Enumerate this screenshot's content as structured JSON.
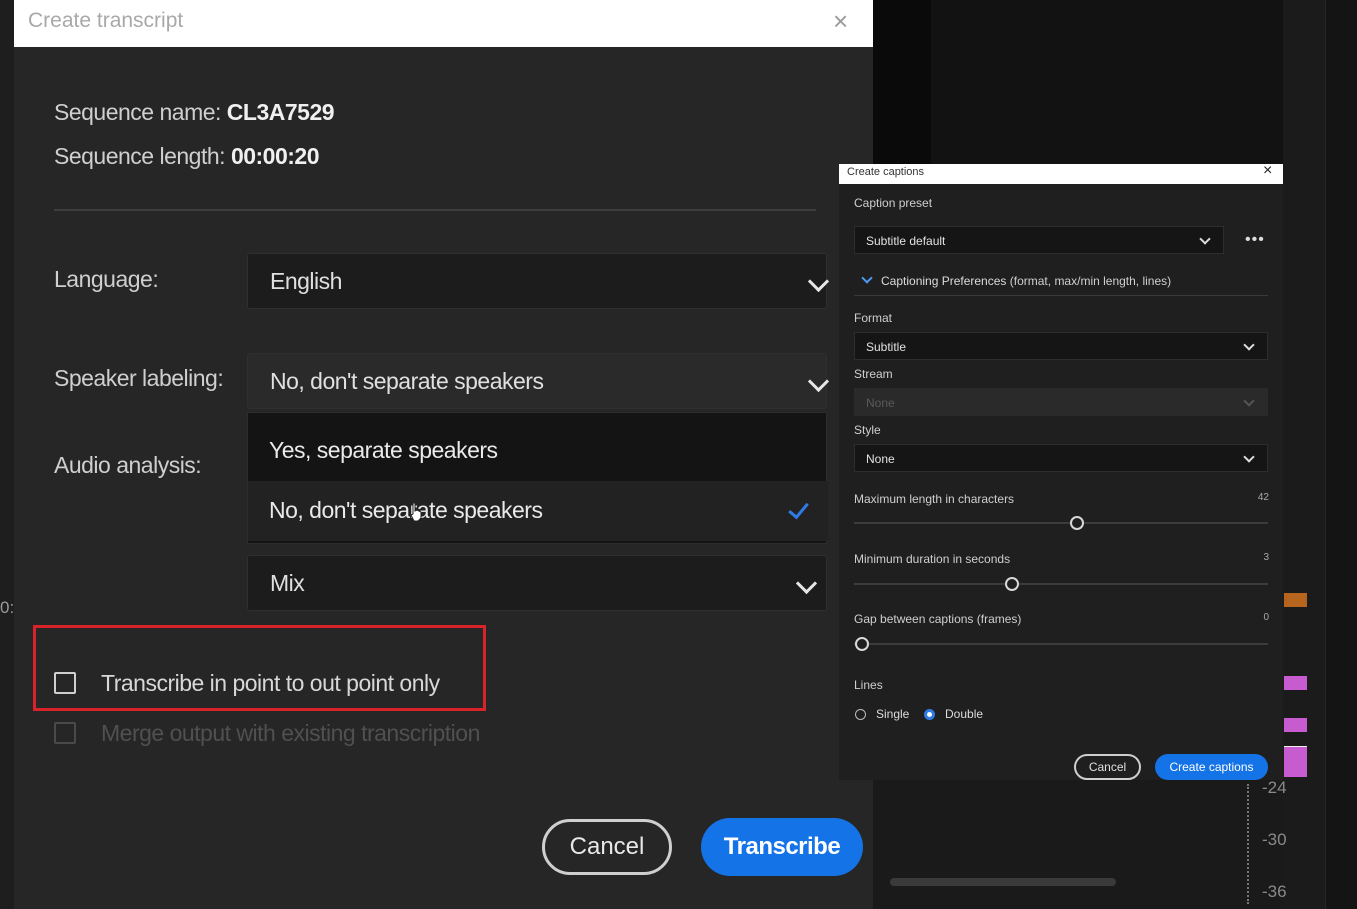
{
  "transcript_dialog": {
    "title": "Create transcript",
    "close_glyph": "×",
    "sequence_name_label": "Sequence name:",
    "sequence_name_value": "CL3A7529",
    "sequence_length_label": "Sequence length:",
    "sequence_length_value": "00:00:20",
    "language_label": "Language:",
    "language_value": "English",
    "speaker_label": "Speaker labeling:",
    "speaker_value": "No, don't separate speakers",
    "speaker_options": [
      "Yes, separate speakers",
      "No, don't separate speakers"
    ],
    "audio_label": "Audio analysis:",
    "audio_value": "Mix",
    "checkbox_in_out": "Transcribe in point to out point only",
    "checkbox_merge": "Merge output with existing transcription",
    "cancel_label": "Cancel",
    "transcribe_label": "Transcribe",
    "accent_color": "#1473e6",
    "highlight_color": "#d8232a"
  },
  "captions_dialog": {
    "title": "Create captions",
    "close_glyph": "×",
    "preset_label": "Caption preset",
    "preset_value": "Subtitle default",
    "more_glyph": "•••",
    "prefs_title": "Captioning Preferences",
    "prefs_subtitle": "(format, max/min length, lines)",
    "format_label": "Format",
    "format_value": "Subtitle",
    "stream_label": "Stream",
    "stream_value": "None",
    "style_label": "Style",
    "style_value": "None",
    "max_length_label": "Maximum length in characters",
    "max_length_value": "42",
    "min_duration_label": "Minimum duration in seconds",
    "min_duration_value": "3",
    "gap_label": "Gap between captions (frames)",
    "gap_value": "0",
    "lines_label": "Lines",
    "lines_single": "Single",
    "lines_double": "Double",
    "lines_selected": "Double",
    "cancel_label": "Cancel",
    "create_label": "Create captions"
  },
  "background": {
    "meter_labels": [
      "-24",
      "-30",
      "-36"
    ],
    "left_edge_label": "0:"
  }
}
